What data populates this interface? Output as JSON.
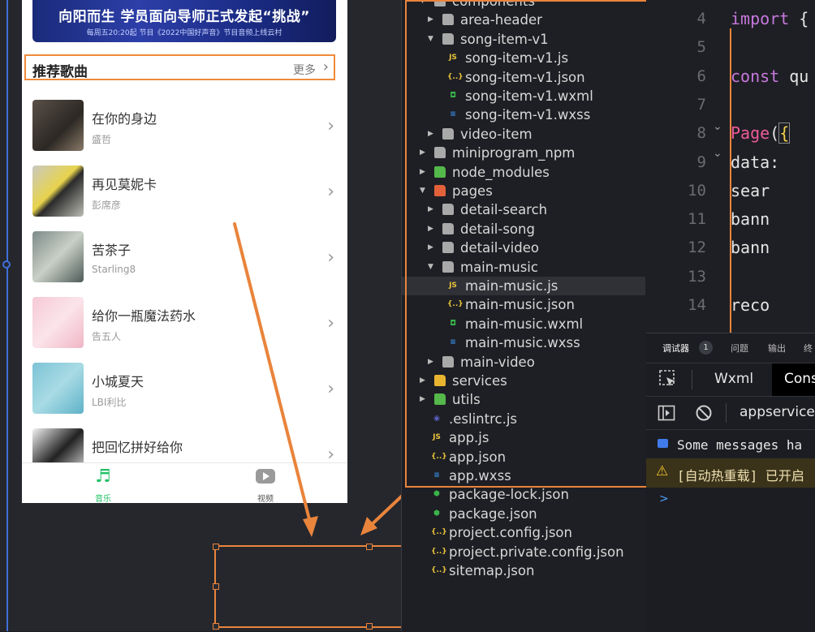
{
  "phone": {
    "banner": {
      "title": "向阳而生 学员面向导师正式发起“挑战”",
      "subtitle": "每周五20:20起 节目《2022中国好声音》节目音频上线云村"
    },
    "section": {
      "title": "推荐歌曲",
      "more": "更多"
    },
    "songs": [
      {
        "name": "在你的身边",
        "artist": "盛哲"
      },
      {
        "name": "再见莫妮卡",
        "artist": "彭席彦"
      },
      {
        "name": "苦茶子",
        "artist": "Starling8"
      },
      {
        "name": "给你一瓶魔法药水",
        "artist": "告五人"
      },
      {
        "name": "小城夏天",
        "artist": "LBI利比"
      },
      {
        "name": "把回忆拼好给你",
        "artist": ""
      }
    ],
    "tabs": [
      {
        "label": "音乐",
        "icon": "music-note-icon"
      },
      {
        "label": "视频",
        "icon": "video-play-icon"
      }
    ],
    "accent": "#20c064"
  },
  "file_tree": {
    "rows": [
      {
        "label": "components",
        "icon": "folder",
        "twisty": "open"
      },
      {
        "label": "area-header",
        "icon": "folder",
        "twisty": "closed"
      },
      {
        "label": "song-item-v1",
        "icon": "folder-open",
        "twisty": "open"
      },
      {
        "label": "song-item-v1.js",
        "icon": "js"
      },
      {
        "label": "song-item-v1.json",
        "icon": "json"
      },
      {
        "label": "song-item-v1.wxml",
        "icon": "wxml"
      },
      {
        "label": "song-item-v1.wxss",
        "icon": "wxss"
      },
      {
        "label": "video-item",
        "icon": "folder",
        "twisty": "closed"
      },
      {
        "label": "miniprogram_npm",
        "icon": "folder",
        "twisty": "closed"
      },
      {
        "label": "node_modules",
        "icon": "folder-green",
        "twisty": "closed"
      },
      {
        "label": "pages",
        "icon": "folder-red",
        "twisty": "open"
      },
      {
        "label": "detail-search",
        "icon": "folder",
        "twisty": "closed"
      },
      {
        "label": "detail-song",
        "icon": "folder",
        "twisty": "closed"
      },
      {
        "label": "detail-video",
        "icon": "folder",
        "twisty": "closed"
      },
      {
        "label": "main-music",
        "icon": "folder-open",
        "twisty": "open"
      },
      {
        "label": "main-music.js",
        "icon": "js",
        "selected": true
      },
      {
        "label": "main-music.json",
        "icon": "json"
      },
      {
        "label": "main-music.wxml",
        "icon": "wxml"
      },
      {
        "label": "main-music.wxss",
        "icon": "wxss"
      },
      {
        "label": "main-video",
        "icon": "folder",
        "twisty": "closed"
      },
      {
        "label": "services",
        "icon": "folder-yellow",
        "twisty": "closed"
      },
      {
        "label": "utils",
        "icon": "folder-green",
        "twisty": "closed"
      },
      {
        "label": ".eslintrc.js",
        "icon": "eslint"
      },
      {
        "label": "app.js",
        "icon": "js"
      },
      {
        "label": "app.json",
        "icon": "json"
      },
      {
        "label": "app.wxss",
        "icon": "wxss"
      },
      {
        "label": "package-lock.json",
        "icon": "npm"
      },
      {
        "label": "package.json",
        "icon": "npm"
      },
      {
        "label": "project.config.json",
        "icon": "json"
      },
      {
        "label": "project.private.config.json",
        "icon": "json"
      },
      {
        "label": "sitemap.json",
        "icon": "json"
      }
    ]
  },
  "editor": {
    "lines": [
      {
        "no": "4",
        "parts": [
          [
            "import",
            "kw"
          ],
          [
            " {",
            "punc"
          ]
        ]
      },
      {
        "no": "5",
        "parts": []
      },
      {
        "no": "6",
        "parts": [
          [
            "const",
            "kw"
          ],
          [
            " qu",
            "id"
          ]
        ]
      },
      {
        "no": "7",
        "parts": []
      },
      {
        "no": "8",
        "parts": [
          [
            "Page",
            "fn"
          ],
          [
            "(",
            "punc"
          ],
          [
            "{",
            "brace"
          ]
        ]
      },
      {
        "no": "9",
        "parts": [
          [
            "  data:",
            "id"
          ]
        ]
      },
      {
        "no": "10",
        "parts": [
          [
            "    sear",
            "id"
          ]
        ]
      },
      {
        "no": "11",
        "parts": [
          [
            "    bann",
            "id"
          ]
        ]
      },
      {
        "no": "12",
        "parts": [
          [
            "    bann",
            "id"
          ]
        ]
      },
      {
        "no": "13",
        "parts": []
      },
      {
        "no": "14",
        "parts": [
          [
            "    reco",
            "id"
          ]
        ]
      }
    ]
  },
  "debug": {
    "tabs": [
      "调试器",
      "问题",
      "输出",
      "终"
    ],
    "badge": "1",
    "panel_tabs": [
      "Wxml",
      "Cons"
    ],
    "context": "appservice",
    "messages": [
      {
        "text": "Some messages ha",
        "icon": "message-icon"
      },
      {
        "text": "[自动热重载] 已开启",
        "icon": "warning-icon"
      }
    ],
    "prompt": ">"
  }
}
